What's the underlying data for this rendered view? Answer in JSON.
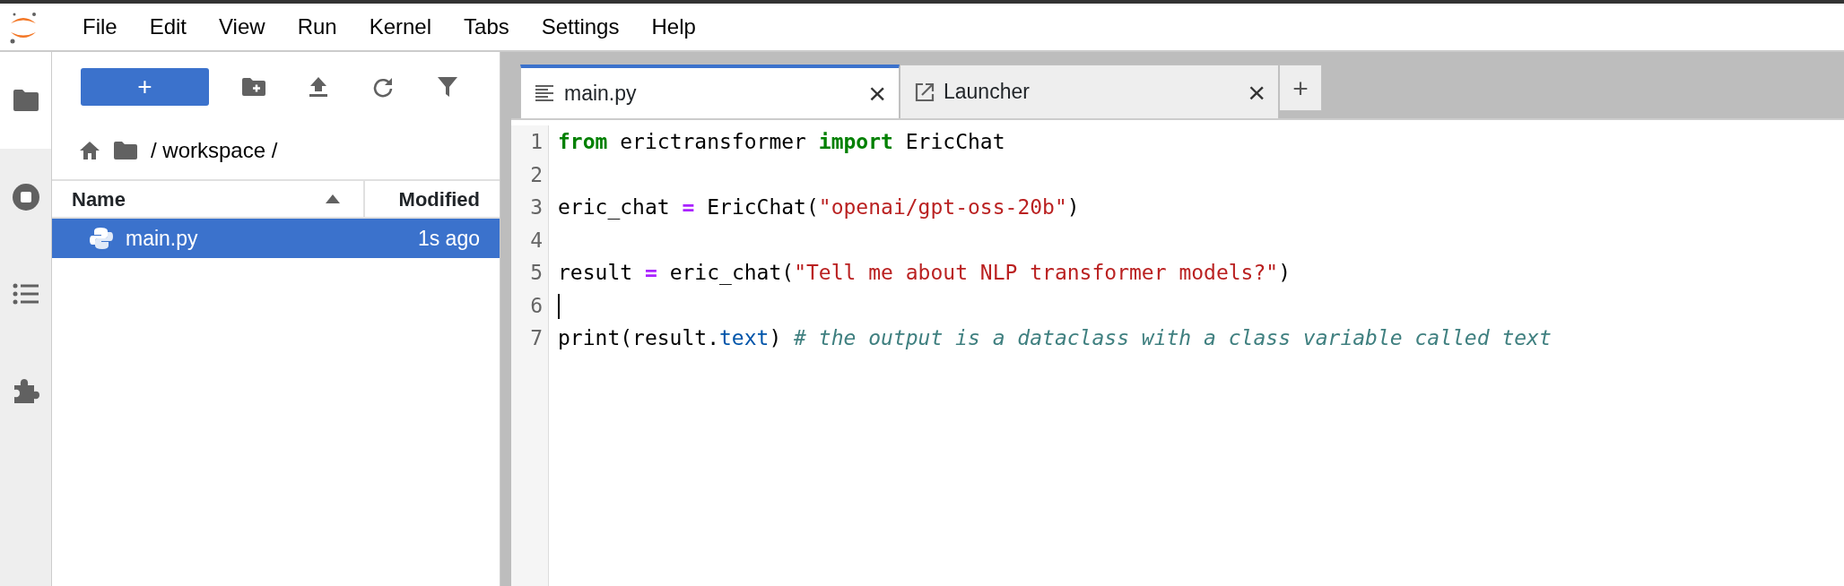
{
  "menu": [
    {
      "label": "File"
    },
    {
      "label": "Edit"
    },
    {
      "label": "View"
    },
    {
      "label": "Run"
    },
    {
      "label": "Kernel"
    },
    {
      "label": "Tabs"
    },
    {
      "label": "Settings"
    },
    {
      "label": "Help"
    }
  ],
  "sidebar": {
    "tabs": [
      {
        "selected": true
      },
      {
        "selected": false
      },
      {
        "selected": false
      },
      {
        "selected": false
      }
    ]
  },
  "file_browser": {
    "new_button": "+",
    "path": "/ workspace /",
    "columns": [
      {
        "label": "Name"
      },
      {
        "label": "Modified"
      }
    ],
    "rows": [
      {
        "name": "main.py",
        "modified": "1s ago",
        "selected": true
      }
    ]
  },
  "tabs": [
    {
      "label": "main.py",
      "kind": "file",
      "selected": true,
      "close": "×"
    },
    {
      "label": "Launcher",
      "kind": "launcher",
      "selected": false,
      "close": "×"
    }
  ],
  "new_tab_button": "+",
  "editor": {
    "lines": [
      {
        "number": "1",
        "cursor": false,
        "tokens": [
          {
            "kind": "keyword",
            "text": "from"
          },
          {
            "kind": "plain",
            "text": " erictransformer "
          },
          {
            "kind": "keyword",
            "text": "import"
          },
          {
            "kind": "plain",
            "text": " EricChat"
          }
        ]
      },
      {
        "number": "2",
        "cursor": false
      },
      {
        "number": "3",
        "cursor": false,
        "tokens": [
          {
            "kind": "plain",
            "text": "eric_chat "
          },
          {
            "kind": "operator",
            "text": "="
          },
          {
            "kind": "plain",
            "text": " EricChat("
          },
          {
            "kind": "string",
            "text": "\"openai/gpt-oss-20b\""
          },
          {
            "kind": "plain",
            "text": ")"
          }
        ]
      },
      {
        "number": "4",
        "cursor": false
      },
      {
        "number": "5",
        "cursor": false,
        "tokens": [
          {
            "kind": "plain",
            "text": "result "
          },
          {
            "kind": "operator",
            "text": "="
          },
          {
            "kind": "plain",
            "text": " eric_chat("
          },
          {
            "kind": "string",
            "text": "\"Tell me about NLP transformer models?\""
          },
          {
            "kind": "plain",
            "text": ")"
          }
        ]
      },
      {
        "number": "6",
        "cursor": true
      },
      {
        "number": "7",
        "cursor": false,
        "tokens": [
          {
            "kind": "plain",
            "text": "print(result."
          },
          {
            "kind": "attribute",
            "text": "text"
          },
          {
            "kind": "plain",
            "text": ") "
          },
          {
            "kind": "comment",
            "text": "# the output is a dataclass with a class variable called text"
          }
        ]
      }
    ]
  }
}
